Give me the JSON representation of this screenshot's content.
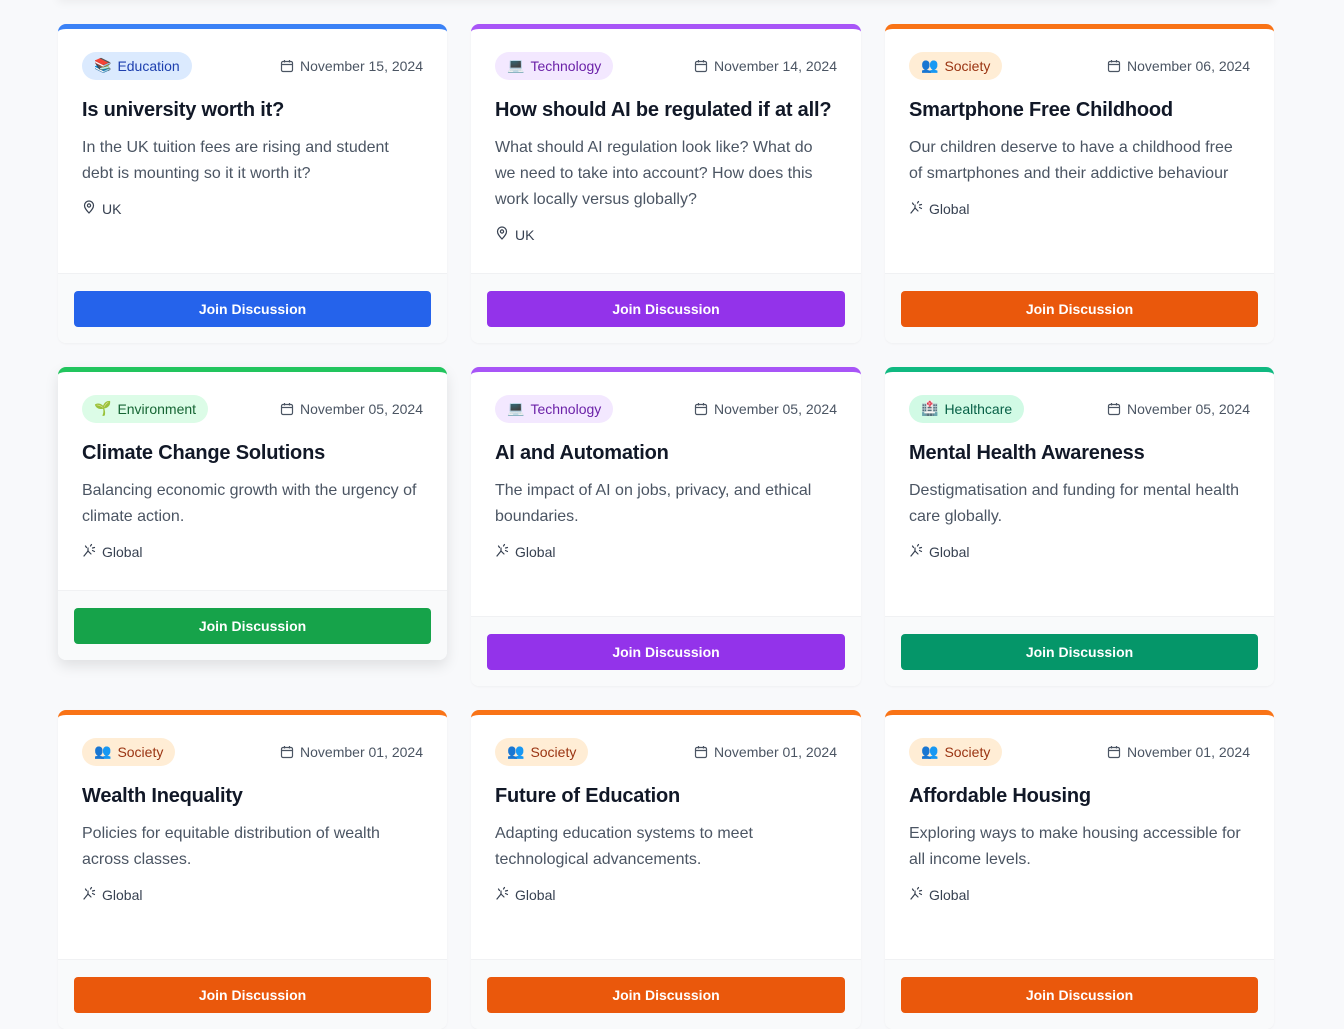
{
  "cards": [
    {
      "category": "Education",
      "icon": "📚",
      "date": "November 15, 2024",
      "title": "Is university worth it?",
      "description": "In the UK tuition fees are rising and student debt is mounting so it it worth it?",
      "location": "UK",
      "location_icon": "pin-icon",
      "button": "Join Discussion",
      "accent": "#3b82f6",
      "badge_bg": "#dbeafe",
      "badge_fg": "#1e40af",
      "button_bg": "#2563eb"
    },
    {
      "category": "Technology",
      "icon": "💻",
      "date": "November 14, 2024",
      "title": "How should AI be regulated if at all?",
      "description": "What should AI regulation look like? What do we need to take into account? How does this work locally versus globally?",
      "location": "UK",
      "location_icon": "pin-icon",
      "button": "Join Discussion",
      "accent": "#a855f7",
      "badge_bg": "#f3e8ff",
      "badge_fg": "#6b21a8",
      "button_bg": "#9333ea"
    },
    {
      "category": "Society",
      "icon": "👥",
      "date": "November 06, 2024",
      "title": "Smartphone Free Childhood",
      "description": "Our children deserve to have a childhood free of smartphones and their addictive behaviour",
      "location": "Global",
      "location_icon": "global-icon",
      "button": "Join Discussion",
      "accent": "#f97316",
      "badge_bg": "#ffedd5",
      "badge_fg": "#9a3412",
      "button_bg": "#ea580c"
    },
    {
      "category": "Environment",
      "icon": "🌱",
      "date": "November 05, 2024",
      "title": "Climate Change Solutions",
      "description": "Balancing economic growth with the urgency of climate action.",
      "location": "Global",
      "location_icon": "global-icon",
      "button": "Join Discussion",
      "accent": "#22c55e",
      "badge_bg": "#dcfce7",
      "badge_fg": "#166534",
      "button_bg": "#16a34a"
    },
    {
      "category": "Technology",
      "icon": "💻",
      "date": "November 05, 2024",
      "title": "AI and Automation",
      "description": "The impact of AI on jobs, privacy, and ethical boundaries.",
      "location": "Global",
      "location_icon": "global-icon",
      "button": "Join Discussion",
      "accent": "#a855f7",
      "badge_bg": "#f3e8ff",
      "badge_fg": "#6b21a8",
      "button_bg": "#9333ea"
    },
    {
      "category": "Healthcare",
      "icon": "🏥",
      "date": "November 05, 2024",
      "title": "Mental Health Awareness",
      "description": "Destigmatisation and funding for mental health care globally.",
      "location": "Global",
      "location_icon": "global-icon",
      "button": "Join Discussion",
      "accent": "#10b981",
      "badge_bg": "#d1fae5",
      "badge_fg": "#065f46",
      "button_bg": "#059669"
    },
    {
      "category": "Society",
      "icon": "👥",
      "date": "November 01, 2024",
      "title": "Wealth Inequality",
      "description": "Policies for equitable distribution of wealth across classes.",
      "location": "Global",
      "location_icon": "global-icon",
      "button": "Join Discussion",
      "accent": "#f97316",
      "badge_bg": "#ffedd5",
      "badge_fg": "#9a3412",
      "button_bg": "#ea580c"
    },
    {
      "category": "Society",
      "icon": "👥",
      "date": "November 01, 2024",
      "title": "Future of Education",
      "description": "Adapting education systems to meet technological advancements.",
      "location": "Global",
      "location_icon": "global-icon",
      "button": "Join Discussion",
      "accent": "#f97316",
      "badge_bg": "#ffedd5",
      "badge_fg": "#9a3412",
      "button_bg": "#ea580c"
    },
    {
      "category": "Society",
      "icon": "👥",
      "date": "November 01, 2024",
      "title": "Affordable Housing",
      "description": "Exploring ways to make housing accessible for all income levels.",
      "location": "Global",
      "location_icon": "global-icon",
      "button": "Join Discussion",
      "accent": "#f97316",
      "badge_bg": "#ffedd5",
      "badge_fg": "#9a3412",
      "button_bg": "#ea580c"
    }
  ]
}
